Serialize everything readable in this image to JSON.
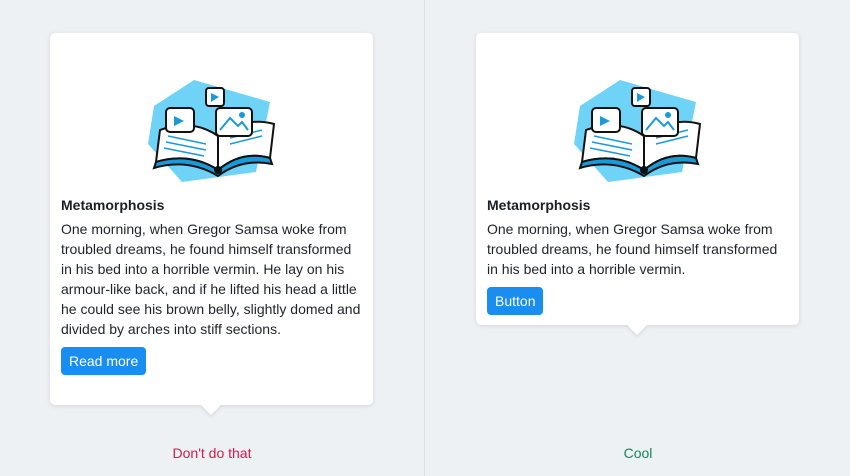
{
  "colors": {
    "background": "#eef1f4",
    "card": "#ffffff",
    "button": "#1a8ef0",
    "bad": "#d8184e",
    "good": "#17855c",
    "illustration_accent": "#6fd3f7"
  },
  "illustration_icon": "open-book-with-media-bubbles-illustration",
  "bad_example": {
    "title": "Metamorphosis",
    "text": "One morning, when Gregor Samsa woke from troubled dreams, he found himself transformed in his bed into a horrible vermin. He lay on his armour-like back, and if he lifted his head a little he could see his brown belly, slightly domed and divided by arches into stiff sections.",
    "button_label": "Read more",
    "caption": "Don't do that"
  },
  "good_example": {
    "title": "Metamorphosis",
    "text": "One morning, when Gregor Samsa woke from troubled dreams, he found himself transformed in his bed into a horrible vermin.",
    "button_label": "Button",
    "caption": "Cool"
  }
}
